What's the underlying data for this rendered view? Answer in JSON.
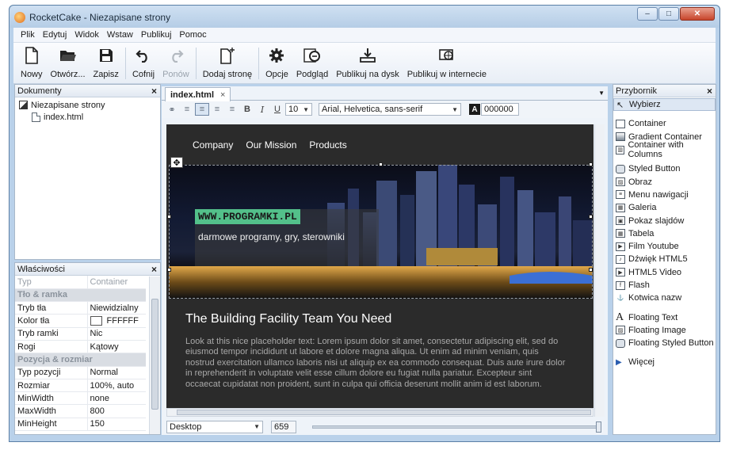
{
  "window": {
    "title": "RocketCake - Niezapisane strony",
    "controls": {
      "minimize": "–",
      "maximize": "□",
      "close": "✕"
    }
  },
  "menu": [
    "Plik",
    "Edytuj",
    "Widok",
    "Wstaw",
    "Publikuj",
    "Pomoc"
  ],
  "toolbar": [
    {
      "label": "Nowy",
      "icon": "new-document-icon",
      "enabled": true
    },
    {
      "label": "Otwórz...",
      "icon": "open-folder-icon",
      "enabled": true
    },
    {
      "label": "Zapisz",
      "icon": "save-icon",
      "enabled": true
    },
    {
      "label": "Cofnij",
      "icon": "undo-icon",
      "enabled": true
    },
    {
      "label": "Ponów",
      "icon": "redo-icon",
      "enabled": false
    },
    {
      "label": "Dodaj stronę",
      "icon": "add-page-icon",
      "enabled": true
    },
    {
      "label": "Opcje",
      "icon": "gear-icon",
      "enabled": true
    },
    {
      "label": "Podgląd",
      "icon": "preview-icon",
      "enabled": true
    },
    {
      "label": "Publikuj na dysk",
      "icon": "publish-disk-icon",
      "enabled": true
    },
    {
      "label": "Publikuj w internecie",
      "icon": "publish-web-icon",
      "enabled": true
    }
  ],
  "documents": {
    "title": "Dokumenty",
    "root": "Niezapisane strony",
    "pages": [
      "index.html"
    ]
  },
  "properties": {
    "title": "Właściwości",
    "header": {
      "key": "Typ",
      "value": "Container"
    },
    "rows": [
      {
        "group": "Tło & ramka"
      },
      {
        "key": "Tryb tła",
        "value": "Niewidzialny"
      },
      {
        "key": "Kolor tła",
        "value": "FFFFFF",
        "swatch": "#ffffff"
      },
      {
        "key": "Tryb ramki",
        "value": "Nic"
      },
      {
        "key": "Rogi",
        "value": "Kątowy"
      },
      {
        "group": "Pozycja & rozmiar"
      },
      {
        "key": "Typ pozycji",
        "value": "Normal"
      },
      {
        "key": "Rozmiar",
        "value": "100%, auto"
      },
      {
        "key": "MinWidth",
        "value": "none"
      },
      {
        "key": "MaxWidth",
        "value": "800"
      },
      {
        "key": "MinHeight",
        "value": "150"
      }
    ]
  },
  "editor": {
    "tab": "index.html",
    "font_size": "10",
    "font_family": "Arial, Helvetica, sans-serif",
    "color_code": "000000",
    "color_label": "A"
  },
  "site": {
    "nav": [
      "Company",
      "Our Mission",
      "Products"
    ],
    "brand": "WWW.PROGRAMKI.PL",
    "tagline": "darmowe programy, gry, sterowniki",
    "heading": "The Building Facility Team You Need",
    "body": "Look at this nice placeholder text: Lorem ipsum dolor sit amet, consectetur adipiscing elit, sed do eiusmod tempor incididunt ut labore et dolore magna aliqua. Ut enim ad minim veniam, quis nostrud exercitation ullamco laboris nisi ut aliquip ex ea commodo consequat. Duis aute irure dolor in reprehenderit in voluptate velit esse cillum dolore eu fugiat nulla pariatur. Excepteur sint occaecat cupidatat non proident, sunt in culpa qui officia deserunt mollit anim id est laborum."
  },
  "statusbar": {
    "device": "Desktop",
    "width_value": "659"
  },
  "toolbox": {
    "title": "Przybornik",
    "select": "Wybierz",
    "groups": [
      [
        "Container",
        "Gradient Container",
        "Container with Columns"
      ],
      [
        "Styled Button",
        "Obraz",
        "Menu nawigacji",
        "Galeria",
        "Pokaz slajdów",
        "Tabela",
        "Film Youtube",
        "Dźwięk HTML5",
        "HTML5 Video",
        "Flash",
        "Kotwica nazw"
      ],
      [
        "Floating Text",
        "Floating Image",
        "Floating Styled Button"
      ]
    ],
    "more": "Więcej"
  },
  "colors": {
    "canvas_bg": "#2b2b2b",
    "brand_badge": "#53c08a",
    "window_frame": "#b9d1ea"
  }
}
